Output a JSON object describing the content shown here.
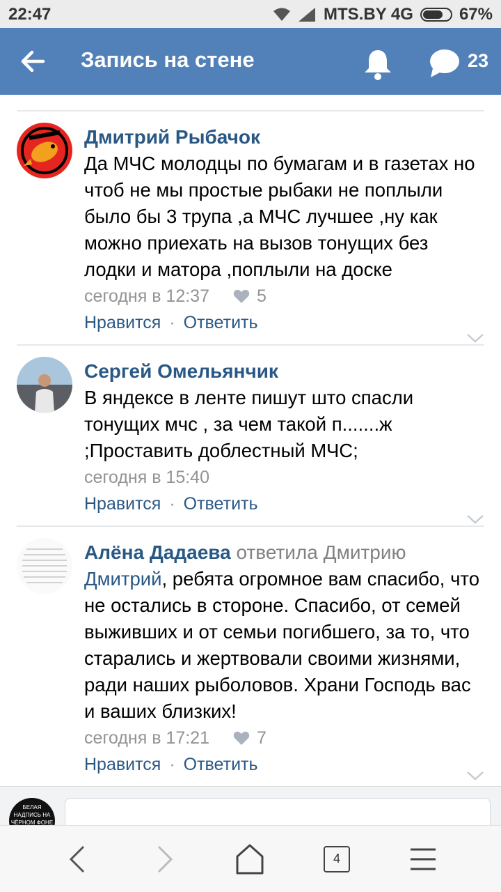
{
  "status_bar": {
    "time": "22:47",
    "carrier": "MTS.BY 4G",
    "battery": "67%",
    "battery_level": 0.67
  },
  "header": {
    "title": "Запись на стене",
    "chat_count": "23"
  },
  "comments": [
    {
      "author": "Дмитрий Рыбачок",
      "text": "Да МЧС молодцы по бумагам и в газетах но чтоб не мы простые рыбаки не поплыли было бы 3 трупа ,а МЧС лучшее ,ну как можно приехать на вызов тонущих без лодки и матора ,поплыли на доске",
      "time": "сегодня в 12:37",
      "likes": "5",
      "like_label": "Нравится",
      "reply_label": "Ответить"
    },
    {
      "author": "Сергей Омельянчик",
      "text": "В яндексе в ленте пишут што спасли тонущих мчс , за чем такой п.......ж ;Проставить доблестный МЧС;",
      "time": "сегодня в 15:40",
      "like_label": "Нравится",
      "reply_label": "Ответить"
    },
    {
      "author": "Алёна Дадаева",
      "replied_to": "ответила Дмитрию",
      "mention": "Дмитрий",
      "text": ", ребята огромное вам спасибо, что не остались в стороне. Спасибо, от семей выживших и от семьи погибшего, за то, что старались и жертвовали своими жизнями, ради наших рыболовов. Храни Господь вас и ваших близких!",
      "time": "сегодня в 17:21",
      "likes": "7",
      "like_label": "Нравится",
      "reply_label": "Ответить"
    }
  ],
  "composer": {
    "avatar_text": "БЕЛАЯ НАДПИСЬ НА ЧЁРНОМ ФОНЕ"
  },
  "browser_nav": {
    "tabs_count": "4"
  },
  "colors": {
    "header": "#5181b8",
    "link": "#2a5885",
    "meta": "#939393"
  }
}
